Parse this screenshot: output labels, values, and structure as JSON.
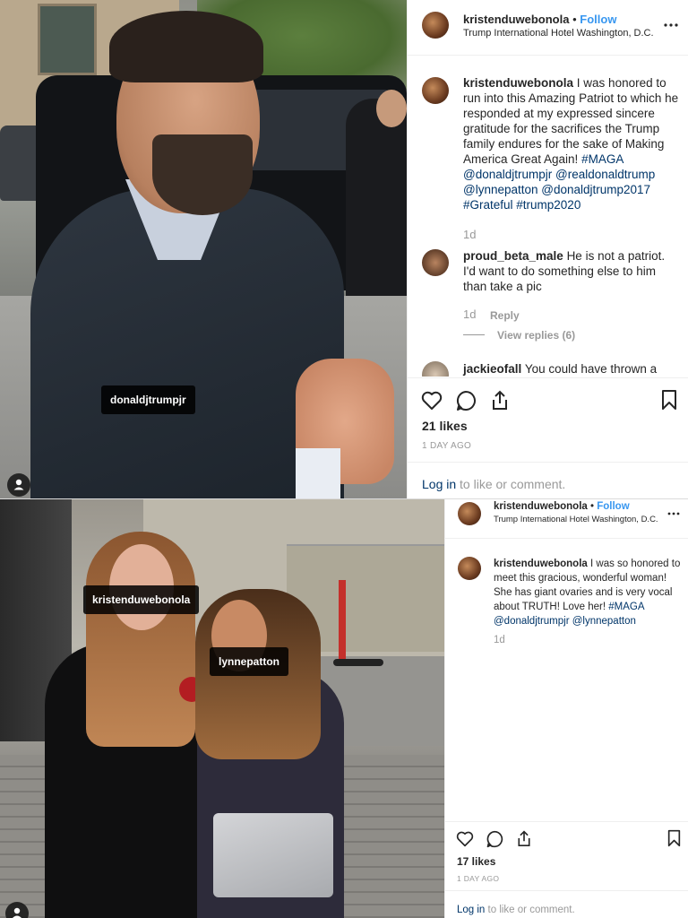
{
  "post1": {
    "username": "kristenduwebonola",
    "follow_label": "Follow",
    "bullet": "•",
    "location": "Trump International Hotel Washington, D.C.",
    "photo_tag": "donaldjtrumpjr",
    "caption_user": "kristenduwebonola",
    "caption_text": "I was honored to run into this Amazing Patriot to which he responded at my expressed sincere gratitude for the sacrifices the Trump family endures for the sake of Making America Great Again!",
    "caption_tags": "#MAGA @donaldjtrumpjr @realdonaldtrump @lynnepatton @donaldjtrump2017 #Grateful #trump2020",
    "caption_time": "1d",
    "comments": [
      {
        "user": "proud_beta_male",
        "text": "He is not a patriot. I'd want to do something else to him than take a pic",
        "time": "1d",
        "reply": "Reply",
        "view_replies": "View replies (6)"
      },
      {
        "user": "jackieofall",
        "text": "You could have thrown a"
      }
    ],
    "likes": "21 likes",
    "ago": "1 DAY AGO",
    "login_link": "Log in",
    "login_rest": " to like or comment."
  },
  "post2": {
    "username": "kristenduwebonola",
    "follow_label": "Follow",
    "bullet": "•",
    "location": "Trump International Hotel Washington, D.C.",
    "photo_tags": [
      "kristenduwebonola",
      "lynnepatton"
    ],
    "caption_user": "kristenduwebonola",
    "caption_text": "I was so honored to meet this gracious, wonderful woman! She has giant ovaries and is very vocal about TRUTH! Love her!",
    "caption_tags": "#MAGA @donaldjtrumpjr @lynnepatton",
    "caption_time": "1d",
    "likes": "17 likes",
    "ago": "1 DAY AGO",
    "login_link": "Log in",
    "login_rest": " to like or comment."
  },
  "icons": [
    "heart-icon",
    "comment-icon",
    "share-icon",
    "bookmark-icon",
    "more-icon",
    "user-tag-icon"
  ],
  "colors": {
    "link": "#003569",
    "follow": "#3897f0",
    "muted": "#999999",
    "text": "#262626"
  }
}
